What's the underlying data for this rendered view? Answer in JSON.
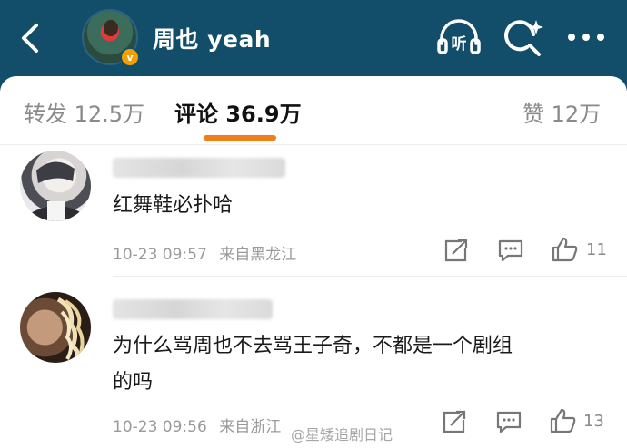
{
  "header": {
    "user_name": "周也 yeah",
    "verified_badge": "v",
    "icons": [
      "back-icon",
      "headphones-listen-icon",
      "search-sparkle-icon",
      "more-dots-icon"
    ],
    "listen_label": "听",
    "background": "#124e6a"
  },
  "tabs": {
    "repost": "转发 12.5万",
    "comments": "评论 36.9万",
    "likes": "赞 12万",
    "indicator_color": "#f27d1b"
  },
  "comments": [
    {
      "text": "红舞鞋必扑哈",
      "time": "10-23 09:57",
      "location": "来自黑龙江",
      "likes": "11"
    },
    {
      "text_line1": "为什么骂周也不去骂王子奇，不都是一个剧组",
      "text_line2": "的吗",
      "time": "10-23 09:56",
      "location": "来自浙江",
      "likes": "13"
    }
  ],
  "watermark": "@星矮追剧日记"
}
